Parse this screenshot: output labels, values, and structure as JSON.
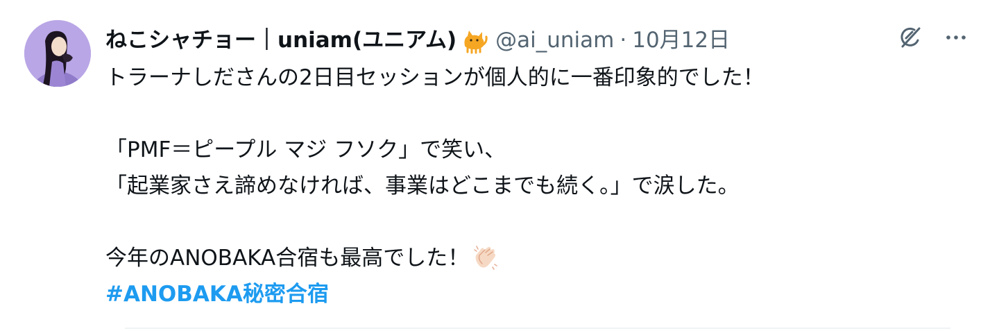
{
  "tweet": {
    "author": {
      "display_name": "ねこシャチョー｜uniam(ユニアム)",
      "name_emoji": "cat-emoji",
      "handle": "@ai_uniam",
      "separator": "·",
      "date": "10月12日"
    },
    "actions": {
      "grok_icon": "grok-icon",
      "more_icon": "more-icon"
    },
    "lines": [
      "トラーナしださんの2日目セッションが個人的に一番印象的でした！",
      "",
      "「PMF＝ピープル マジ フソク」で笑い、",
      "「起業家さえ諦めなければ、事業はどこまでも続く。」で涙した。",
      "",
      "今年のANOBAKA合宿も最高でした！"
    ],
    "line_emoji": "clapping-hands-emoji",
    "hashtag": "#ANOBAKA秘密合宿"
  },
  "colors": {
    "text": "#0f1419",
    "secondary": "#536471",
    "link": "#1d9bf0",
    "avatar_bg": "#b9a6e6"
  }
}
